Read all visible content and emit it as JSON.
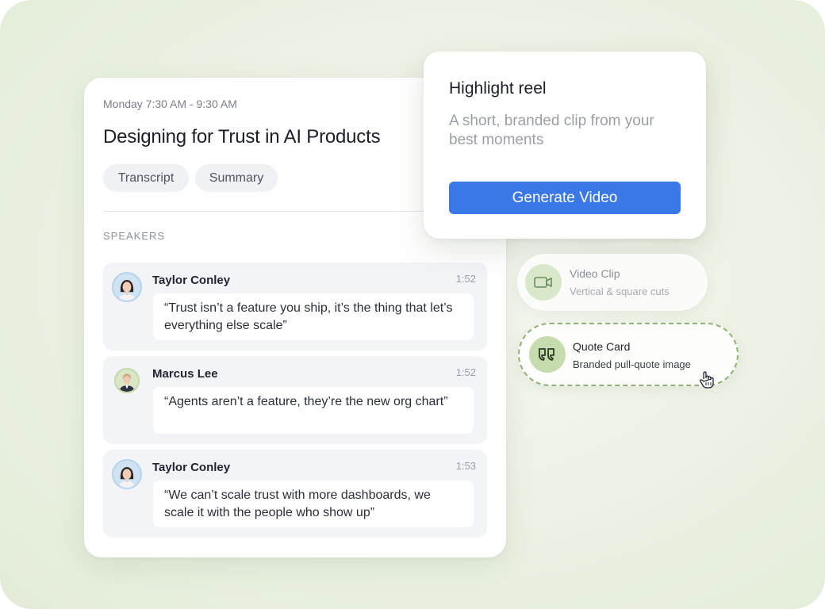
{
  "meeting": {
    "time": "Monday 7:30 AM - 9:30 AM",
    "title": "Designing for Trust in AI Products",
    "tabs": [
      "Transcript",
      "Summary"
    ],
    "speakers_label": "SPEAKERS",
    "entries": [
      {
        "name": "Taylor Conley",
        "time": "1:52",
        "quote": "“Trust isn’t a feature you ship, it’s the thing that let’s everything else scale”",
        "avatar": "woman-avatar"
      },
      {
        "name": "Marcus Lee",
        "time": "1:52",
        "quote": "“Agents aren’t a feature, they’re the new org chart”",
        "avatar": "man-avatar"
      },
      {
        "name": "Taylor Conley",
        "time": "1:53",
        "quote": "“We can’t scale trust with more dashboards, we scale it with the people who show up”",
        "avatar": "woman-avatar"
      }
    ]
  },
  "highlight": {
    "title": "Highlight reel",
    "description": "A short, branded clip from your best moments",
    "button_label": "Generate Video"
  },
  "options": [
    {
      "title": "Video Clip",
      "subtitle": "Vertical & square cuts",
      "icon": "video-camera-icon"
    },
    {
      "title": "Quote Card",
      "subtitle": "Branded pull-quote image",
      "icon": "quote-marks-icon"
    }
  ],
  "colors": {
    "accent_blue": "#3b78e7",
    "green_accent": "#8fb374",
    "background": "#eef3e6"
  }
}
